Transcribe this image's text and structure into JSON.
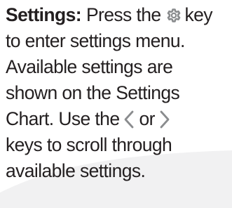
{
  "settings_text": {
    "heading": "Settings:",
    "line1_before_icon": "Press the",
    "gear_icon": "gear-icon",
    "line1_after_icon": "key",
    "line2": "to enter settings menu.",
    "line3": "Available settings are",
    "line4": "shown on the Settings",
    "line5_before_icons": "Chart.  Use the",
    "left_icon": "chevron-left-icon",
    "or_word": "or",
    "right_icon": "chevron-right-icon",
    "line6": "keys to scroll through",
    "line7": "available settings."
  },
  "colors": {
    "text": "#231f20",
    "icon": "#8a8c8e",
    "background_curve": "#f1f1f2"
  }
}
